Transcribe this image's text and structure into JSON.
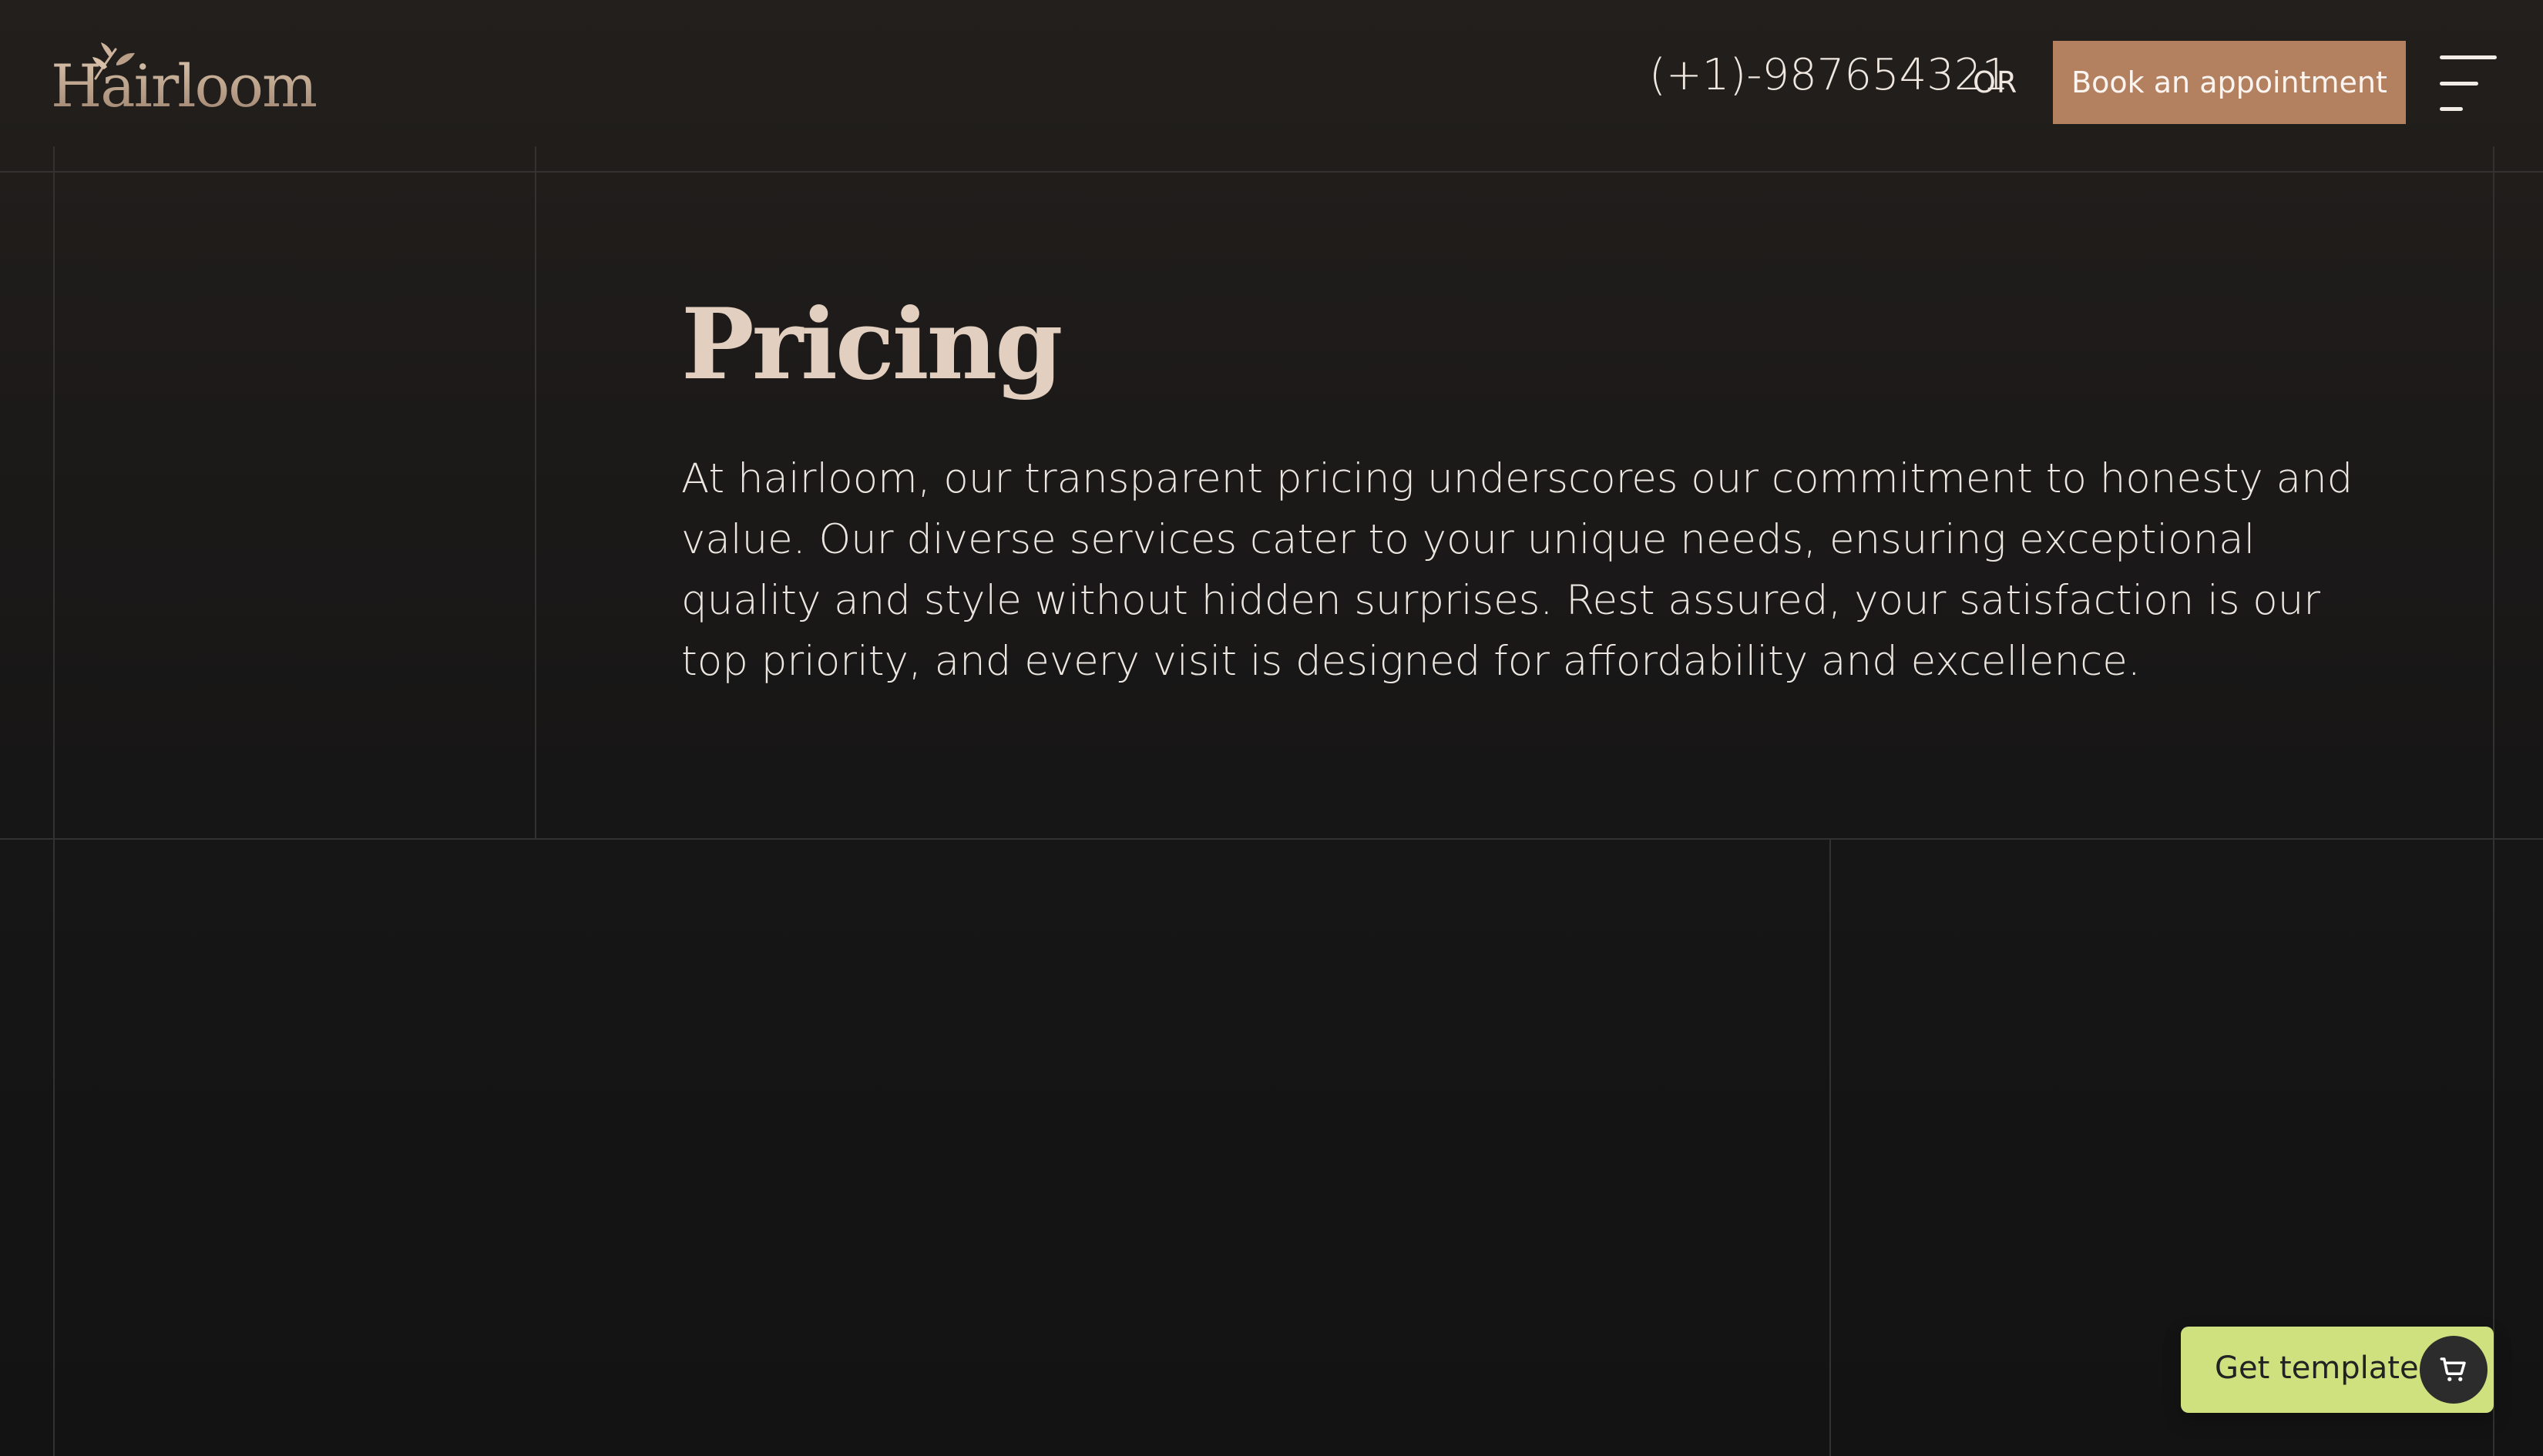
{
  "brand": {
    "name": "Hairloom"
  },
  "header": {
    "phone": "(+1)-987654321",
    "or_text": "OR",
    "book_label": "Book an appointment",
    "menu_icon": "hamburger-menu-icon"
  },
  "pricing": {
    "title": "Pricing",
    "description": "At hairloom, our transparent pricing underscores our commitment to honesty and value. Our diverse services cater to your unique needs, ensuring exceptional quality and style without hidden surprises. Rest assured, your satisfaction is our top priority, and every visit is designed for affordability and excellence."
  },
  "template_cta": {
    "label": "Get template",
    "icon": "cart-icon"
  },
  "colors": {
    "background_top": "#221f1c",
    "background_bottom": "#131313",
    "accent_brown": "#b38060",
    "heading_beige": "#e3cfbf",
    "cta_green": "#cfe07e",
    "grid_line": "#343230"
  }
}
